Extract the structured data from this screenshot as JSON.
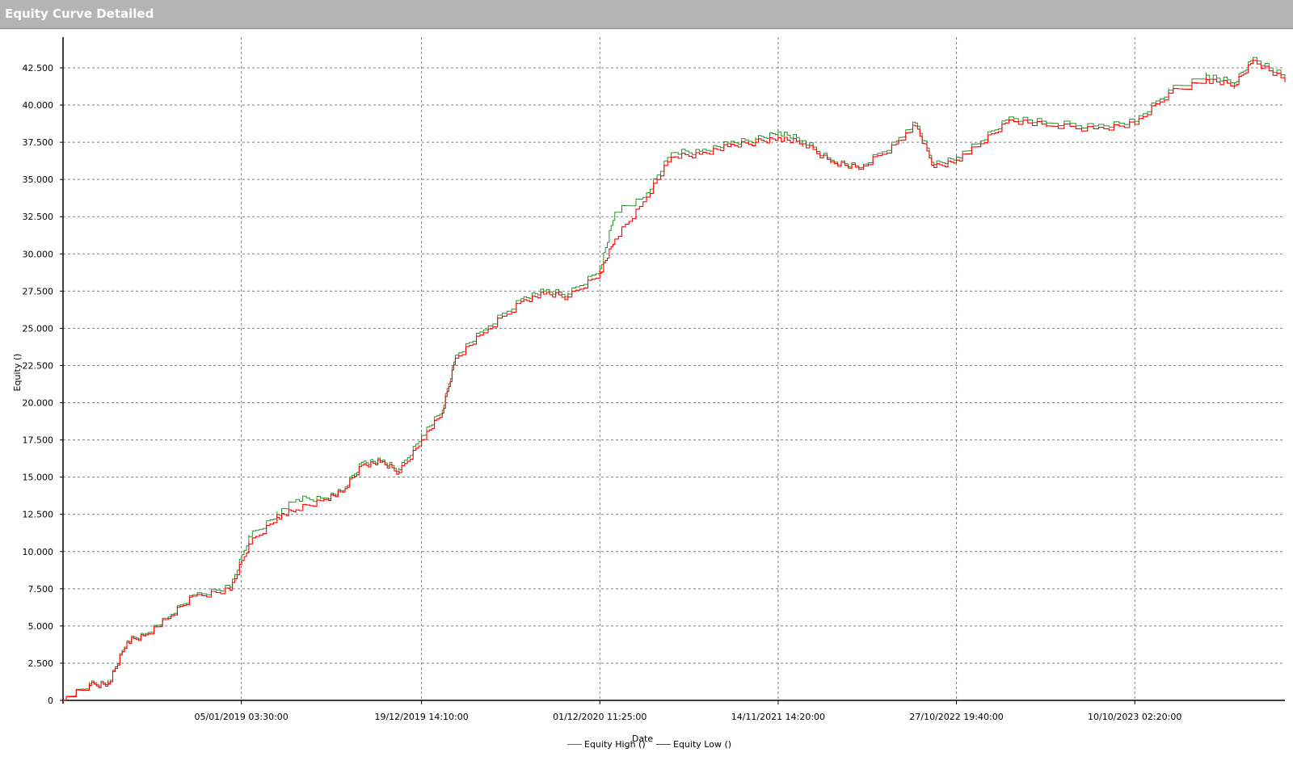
{
  "window": {
    "title": "Equity Curve Detailed"
  },
  "colors": {
    "equity_high": "#2e8b2e",
    "equity_low": "#ff0000",
    "grid": "#7f7f7f",
    "titlebar": "#b4b4b4"
  },
  "chart_data": {
    "type": "line",
    "title": "",
    "xlabel": "Date",
    "ylabel": "Equity ()",
    "x_tick_labels": [
      "05/01/2019 03:30:00",
      "19/12/2019 14:10:00",
      "01/12/2020 11:25:00",
      "14/11/2021 14:20:00",
      "27/10/2022 19:40:00",
      "10/10/2023 02:20:00"
    ],
    "y_ticks": [
      0,
      2500,
      5000,
      7500,
      10000,
      12500,
      15000,
      17500,
      20000,
      22500,
      25000,
      27500,
      30000,
      32500,
      35000,
      37500,
      40000,
      42500
    ],
    "y_tick_labels": [
      "0",
      "2.500",
      "5.000",
      "7.500",
      "10.000",
      "12.500",
      "15.000",
      "17.500",
      "20.000",
      "22.500",
      "25.000",
      "27.500",
      "30.000",
      "32.500",
      "35.000",
      "37.500",
      "40.000",
      "42.500"
    ],
    "ylim": [
      0,
      42500
    ],
    "grid": true,
    "legend_position": "bottom-center",
    "x_tick_position_years": [
      2019.01,
      2019.97,
      2020.92,
      2021.87,
      2022.82,
      2023.77
    ],
    "xlim_years": [
      2018.06,
      2024.57
    ],
    "series": [
      {
        "name": "Equity High ()",
        "x_years": [
          2018.06,
          2018.2,
          2018.3,
          2018.4,
          2018.5,
          2018.62,
          2018.75,
          2018.95,
          2019.05,
          2019.2,
          2019.3,
          2019.45,
          2019.55,
          2019.65,
          2019.75,
          2019.85,
          2019.97,
          2020.08,
          2020.15,
          2020.3,
          2020.5,
          2020.62,
          2020.75,
          2020.92,
          2021.0,
          2021.15,
          2021.3,
          2021.45,
          2021.6,
          2021.75,
          2021.87,
          2022.0,
          2022.15,
          2022.3,
          2022.5,
          2022.6,
          2022.7,
          2022.82,
          2022.95,
          2023.1,
          2023.3,
          2023.55,
          2023.77,
          2023.95,
          2024.15,
          2024.3,
          2024.4,
          2024.57
        ],
        "values": [
          0,
          1100,
          1200,
          4000,
          4500,
          5600,
          7100,
          7600,
          11000,
          12500,
          13500,
          13600,
          14100,
          16000,
          16100,
          15500,
          17800,
          19500,
          23200,
          24900,
          27000,
          27500,
          27300,
          29000,
          32800,
          33800,
          36800,
          36900,
          37400,
          37700,
          38200,
          37600,
          36300,
          35800,
          37600,
          38800,
          36000,
          36500,
          37600,
          39200,
          38800,
          38600,
          38900,
          41000,
          42000,
          41500,
          43200,
          41800
        ]
      },
      {
        "name": "Equity Low ()",
        "x_years": [
          2018.06,
          2018.2,
          2018.3,
          2018.4,
          2018.5,
          2018.62,
          2018.75,
          2018.95,
          2019.05,
          2019.2,
          2019.3,
          2019.45,
          2019.55,
          2019.65,
          2019.75,
          2019.85,
          2019.97,
          2020.08,
          2020.15,
          2020.3,
          2020.5,
          2020.62,
          2020.75,
          2020.92,
          2021.0,
          2021.15,
          2021.3,
          2021.45,
          2021.6,
          2021.75,
          2021.87,
          2022.0,
          2022.15,
          2022.3,
          2022.5,
          2022.6,
          2022.7,
          2022.82,
          2022.95,
          2023.1,
          2023.3,
          2023.55,
          2023.77,
          2023.95,
          2024.15,
          2024.3,
          2024.4,
          2024.57
        ],
        "values": [
          0,
          1000,
          1100,
          3900,
          4400,
          5500,
          7000,
          7400,
          10500,
          12300,
          12800,
          13500,
          14000,
          15800,
          16000,
          15300,
          17500,
          19300,
          23000,
          24700,
          26800,
          27300,
          27100,
          28700,
          31000,
          33500,
          36500,
          36700,
          37200,
          37500,
          37800,
          37400,
          36200,
          35700,
          37400,
          38600,
          35800,
          36300,
          37400,
          39000,
          38600,
          38400,
          38700,
          40800,
          41700,
          41300,
          43000,
          41600
        ]
      }
    ]
  },
  "legend": {
    "items": [
      {
        "label": "Equity High ()"
      },
      {
        "label": "Equity Low ()"
      }
    ]
  }
}
